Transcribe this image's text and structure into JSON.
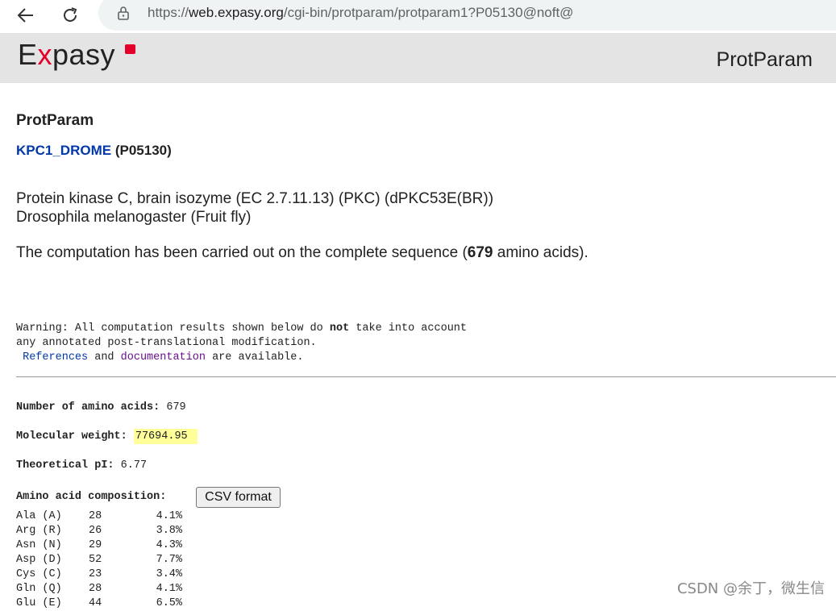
{
  "browser": {
    "url_prefix": "https://",
    "url_host": "web.expasy.org",
    "url_path": "/cgi-bin/protparam/protparam1?P05130@noft@"
  },
  "header": {
    "logo_e": "E",
    "logo_x": "x",
    "logo_rest": "pasy",
    "title": "ProtParam"
  },
  "content": {
    "heading": "ProtParam",
    "entry_name": "KPC1_DROME",
    "entry_id": "(P05130)",
    "protein_name": "Protein kinase C, brain isozyme (EC 2.7.11.13) (PKC) (dPKC53E(BR))",
    "organism": "Drosophila melanogaster (Fruit fly)",
    "computation_pre": "The computation has been carried out on the complete sequence (",
    "computation_count": "679",
    "computation_post": " amino acids).",
    "warning_1a": "Warning: All computation results shown below do ",
    "warning_bold": "not",
    "warning_1b": " take into account",
    "warning_2": "any annotated post-translational modification.",
    "warning_3a": " ",
    "references_link": "References",
    "warning_3b": " and ",
    "documentation_link": "documentation",
    "warning_3c": " are available.",
    "num_aa_label": "Number of amino acids:",
    "num_aa_value": "679",
    "mw_label": "Molecular weight:",
    "mw_value": "77694.95",
    "pi_label": "Theoretical pI:",
    "pi_value": "6.77",
    "composition_label": "Amino acid composition:",
    "csv_button": "CSV format",
    "composition": [
      {
        "name": "Ala (A)",
        "count": "28",
        "pct": "4.1%"
      },
      {
        "name": "Arg (R)",
        "count": "26",
        "pct": "3.8%"
      },
      {
        "name": "Asn (N)",
        "count": "29",
        "pct": "4.3%"
      },
      {
        "name": "Asp (D)",
        "count": "52",
        "pct": "7.7%"
      },
      {
        "name": "Cys (C)",
        "count": "23",
        "pct": "3.4%"
      },
      {
        "name": "Gln (Q)",
        "count": "28",
        "pct": "4.1%"
      },
      {
        "name": "Glu (E)",
        "count": "44",
        "pct": "6.5%"
      }
    ]
  },
  "watermark": "CSDN @余丁，微生信"
}
